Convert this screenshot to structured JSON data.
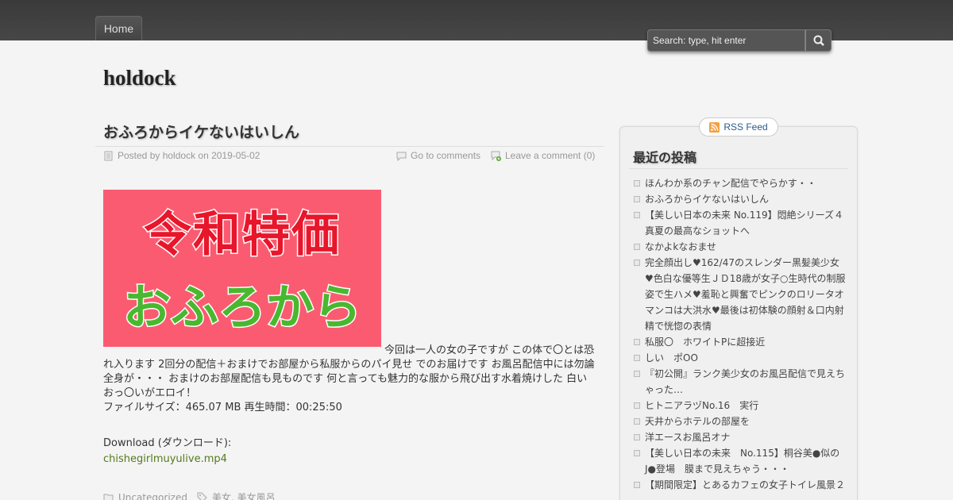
{
  "nav": {
    "home": "Home"
  },
  "search": {
    "placeholder": "Search: type, hit enter"
  },
  "site": {
    "title": "holdock"
  },
  "post": {
    "title": "おふろからイケないはいしん",
    "posted_by": "Posted by holdock on 2019-05-02",
    "comments_link": "Go to comments",
    "leave_comment": "Leave a comment (0)",
    "image_line1": "令和特価",
    "image_line2": "おふろから",
    "body_first": "今回は一人の女の子ですが この体で〇とは恐れ入ります 2回分の配信＋おまけでお部屋から私服からのパイ見せ でのお届けです お風呂配信中には勿論全身が・・・ おまけのお部屋配信も見ものです 何と言っても魅力的な服から飛び出す水着焼けした 白いおっ〇いがエロイ！",
    "file_info": "ファイルサイズ：465.07 MB 再生時間：00:25:50",
    "download_label": "Download (ダウンロード):",
    "download_file": "chishegirlmuyulive.mp4",
    "category": "Uncategorized",
    "tags": "美女, 美女風呂"
  },
  "sidebar": {
    "rss": "RSS Feed",
    "recent_title": "最近の投稿",
    "recent": [
      "ほんわか系のチャン配信でやらかす・・",
      "おふろからイケないはいしん",
      "【美しい日本の未来 No.119】悶絶シリーズ４　真夏の最高なショットへ",
      "なかよkなおませ",
      "完全顔出し♥162/47のスレンダー黒髪美少女♥色白な優等生ＪＤ18歳が女子○生時代の制服姿で生ハメ♥羞恥と興奮でピンクのロリータオマンコは大洪水♥最後は初体験の顔射＆口内射精で恍惚の表情",
      "私服〇　ホワイトPに超接近",
      "しい　ポOO",
      "『初公開』ランク美少女のお風呂配信で見えちゃった…",
      "ヒトニアラヅNo.16　実行",
      "天井からホテルの部屋を",
      "洋エースお風呂オナ",
      "【美しい日本の未来　No.115】桐谷美●似のJ●登場　膜まで見えちゃう・・・",
      "【期間限定】とあるカフェの女子トイレ風景２"
    ]
  }
}
